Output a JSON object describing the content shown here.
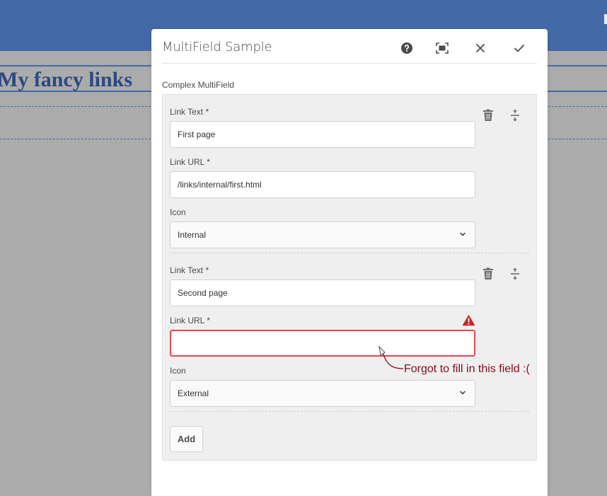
{
  "background": {
    "heading": "My fancy links"
  },
  "dialog": {
    "title": "MultiField Sample",
    "buttons": {
      "help": "help-icon",
      "fullscreen": "fullscreen-icon",
      "close": "close-icon",
      "done": "checkmark-icon"
    },
    "multifield_label": "Complex MultiField",
    "items": [
      {
        "link_text_label": "Link Text *",
        "link_text_value": "First page",
        "link_url_label": "Link URL *",
        "link_url_value": "/links/internal/first.html",
        "icon_label": "Icon",
        "icon_value": "Internal"
      },
      {
        "link_text_label": "Link Text *",
        "link_text_value": "Second page",
        "link_url_label": "Link URL *",
        "link_url_value": "",
        "icon_label": "Icon",
        "icon_value": "External"
      }
    ],
    "add_label": "Add"
  },
  "annotation": "Forgot to fill in this field :(",
  "colors": {
    "topbar": "#4469a8",
    "error": "#e34850",
    "annotation": "#8b0a1e"
  }
}
